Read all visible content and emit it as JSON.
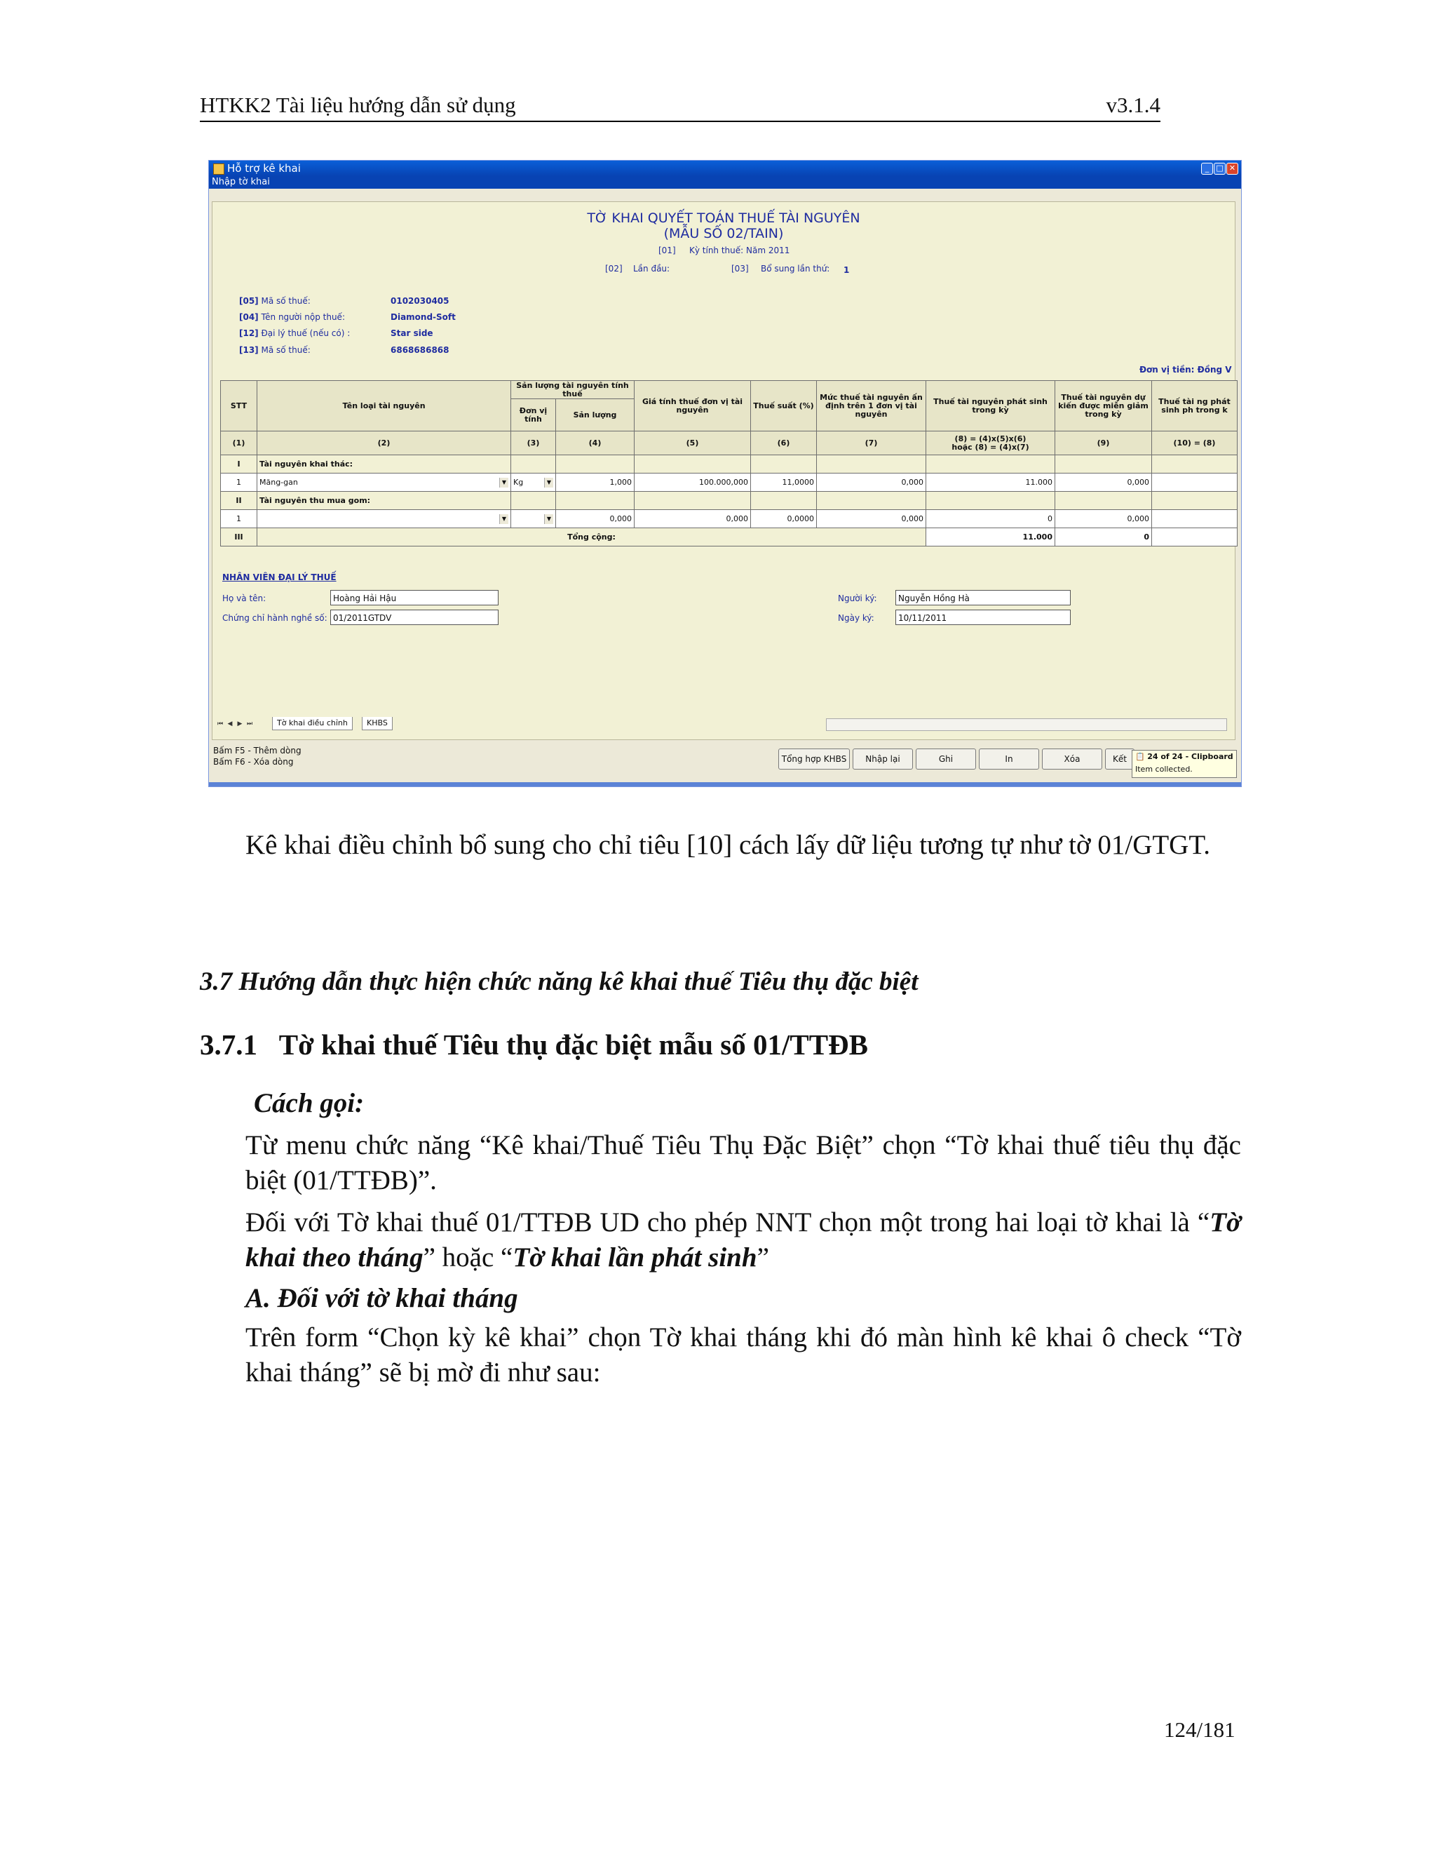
{
  "header": {
    "doc_title": "HTKK2 Tài liệu hướng dẫn sử dụng",
    "version": "v3.1.4"
  },
  "window": {
    "title": "Hỗ trợ kê khai",
    "menu": "Nhập tờ khai",
    "form_title_1": "TỜ KHAI QUYẾT TOÁN THUẾ TÀI NGUYÊN",
    "form_title_2": "(MẪU SỐ 02/TAIN)",
    "period_code": "[01]",
    "period_label": "Kỳ tính thuế: Năm 2011",
    "first_code": "[02]",
    "first_label": "Lần đầu:",
    "supp_code": "[03]",
    "supp_label": "Bổ sung lần thứ:",
    "supp_value": "1",
    "taxpayer": [
      {
        "code": "[05]",
        "label": "Mã số thuế:",
        "value": "0102030405"
      },
      {
        "code": "[04]",
        "label": "Tên người nộp thuế:",
        "value": "Diamond-Soft"
      },
      {
        "code": "[12]",
        "label": "Đại lý thuế (nếu có) :",
        "value": "Star side"
      },
      {
        "code": "[13]",
        "label": "Mã số thuế:",
        "value": "6868686868"
      }
    ],
    "currency": "Đơn vị tiền: Đồng V",
    "table": {
      "headers": {
        "stt": "STT",
        "name": "Tên loại tài nguyên",
        "output_group": "Sản lượng tài nguyên tính thuế",
        "unit": "Đơn vị tính",
        "quantity": "Sản lượng",
        "price": "Giá tính thuế đơn vị tài nguyên",
        "rate": "Thuế suất (%)",
        "fixed": "Mức thuế tài nguyên ấn định trên 1 đơn vị tài nguyên",
        "arising": "Thuế tài nguyên phát sinh trong kỳ",
        "reduce": "Thuế tài nguyên dự kiến được miễn giảm trong kỳ",
        "payable": "Thuế tài ng phát sinh ph trong k"
      },
      "index": [
        "(1)",
        "(2)",
        "(3)",
        "(4)",
        "(5)",
        "(6)",
        "(7)",
        "(8) = (4)x(5)x(6)",
        "hoặc (8) = (4)x(7)",
        "(9)",
        "(10) = (8)"
      ],
      "section1": {
        "stt": "I",
        "label": "Tài nguyên khai thác:"
      },
      "row1": {
        "stt": "1",
        "name": "Măng-gan",
        "unit": "Kg",
        "quantity": "1,000",
        "price": "100.000,000",
        "rate": "11,0000",
        "fixed": "0,000",
        "arising": "11.000",
        "reduce": "0,000"
      },
      "section2": {
        "stt": "II",
        "label": "Tài nguyên thu mua gom:"
      },
      "row2": {
        "stt": "1",
        "name": "",
        "unit": "",
        "quantity": "0,000",
        "price": "0,000",
        "rate": "0,0000",
        "fixed": "0,000",
        "arising": "0",
        "reduce": "0,000"
      },
      "total": {
        "stt": "III",
        "label": "Tổng cộng:",
        "arising": "11.000",
        "reduce": "0"
      }
    },
    "agent": {
      "heading": "NHÂN VIÊN ĐẠI LÝ THUẾ",
      "name_label": "Họ và tên:",
      "name_value": "Hoàng Hải Hậu",
      "cert_label": "Chứng chỉ hành nghề số:",
      "cert_value": "01/2011GTDV",
      "signer_label": "Người ký:",
      "signer_value": "Nguyễn Hồng Hà",
      "date_label": "Ngày ký:",
      "date_value": "10/11/2011"
    },
    "tabs": [
      "Tờ khai điều chỉnh",
      "KHBS"
    ],
    "status": [
      "Bấm F5 - Thêm dòng",
      "Bấm F6 - Xóa dòng"
    ],
    "buttons": [
      "Tổng hợp KHBS",
      "Nhập lại",
      "Ghi",
      "In",
      "Xóa",
      "Kết"
    ],
    "clipboard": {
      "title": "24 of 24 - Clipboard",
      "text": "Item collected."
    }
  },
  "body": {
    "para1": "Kê khai điều chỉnh bổ sung cho chỉ tiêu  [10] cách lấy dữ liệu tương tự như tờ 01/GTGT.",
    "sub_heading": "3.7 Hướng dẫn thực hiện chức năng kê khai thuế Tiêu thụ đặc biệt",
    "sec_num": "3.7.1",
    "sec_title": "Tờ khai thuế Tiêu thụ đặc biệt mẫu số 01/TTĐB",
    "call_heading": "Cách gọi:",
    "para2": "Từ menu chức năng “Kê khai/Thuế Tiêu Thụ Đặc Biệt” chọn “Tờ khai thuế tiêu thụ đặc biệt (01/TTĐB)”.",
    "para3_a": "Đối với Tờ khai thuế 01/TTĐB UD cho phép NNT chọn một trong hai loại tờ khai là “",
    "para3_b": "Tờ khai theo tháng",
    "para3_c": "” hoặc “",
    "para3_d": "Tờ khai lần phát sinh",
    "para3_e": "”",
    "sub_a": "A.  Đối với tờ khai tháng",
    "para4": "Trên form “Chọn kỳ kê khai” chọn Tờ khai tháng khi đó màn hình kê khai ô check “Tờ khai tháng” sẽ bị mờ đi như sau:"
  },
  "footer": {
    "page": "124/181"
  }
}
